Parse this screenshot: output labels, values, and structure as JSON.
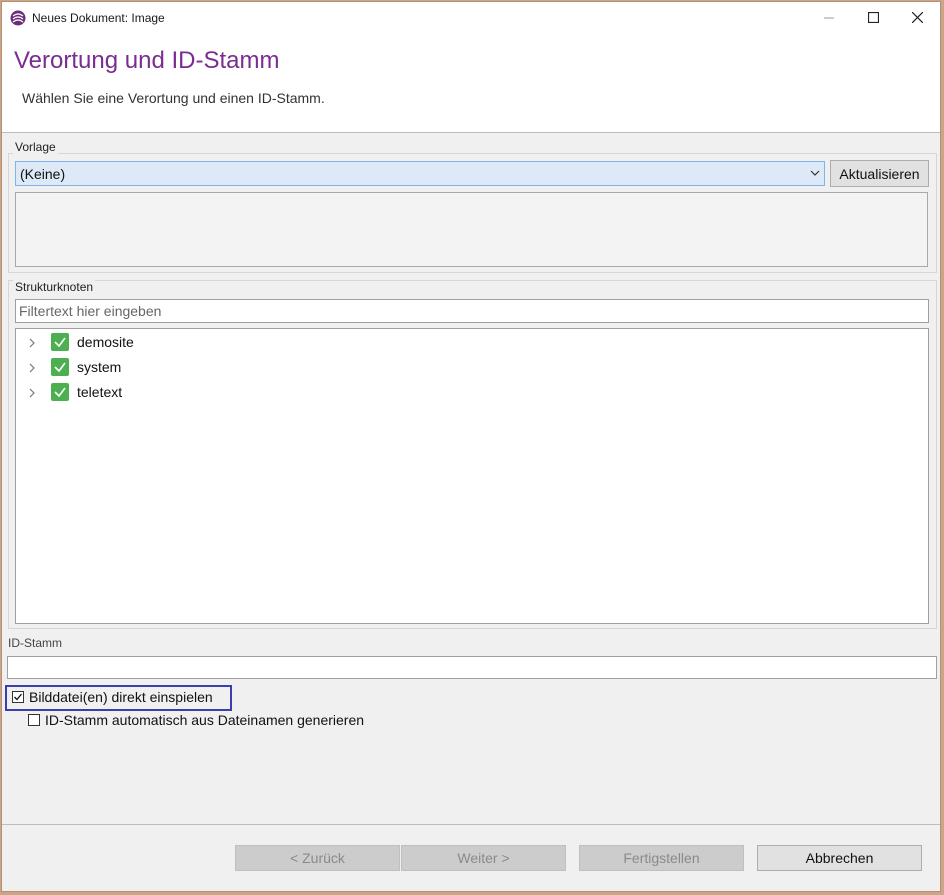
{
  "window": {
    "title": "Neues Dokument: Image",
    "minimize_icon": "minimize-icon",
    "maximize_icon": "maximize-icon",
    "close_icon": "close-icon"
  },
  "header": {
    "title": "Verortung und ID-Stamm",
    "subtitle": "Wählen Sie eine Verortung und einen ID-Stamm."
  },
  "vorlage": {
    "label": "Vorlage",
    "selected": "(Keine)",
    "refresh_label": "Aktualisieren"
  },
  "strukturknoten": {
    "label": "Strukturknoten",
    "filter_placeholder": "Filtertext hier eingeben",
    "items": [
      {
        "label": "demosite",
        "checked": true
      },
      {
        "label": "system",
        "checked": true
      },
      {
        "label": "teletext",
        "checked": true
      }
    ]
  },
  "idstamm": {
    "label": "ID-Stamm",
    "value": ""
  },
  "options": {
    "bilddatei_label": "Bilddatei(en) direkt einspielen",
    "bilddatei_checked": true,
    "auto_id_label": "ID-Stamm automatisch aus Dateinamen generieren",
    "auto_id_checked": false
  },
  "footer": {
    "back_label": "< Zurück",
    "next_label": "Weiter >",
    "finish_label": "Fertigstellen",
    "cancel_label": "Abbrechen"
  },
  "colors": {
    "accent_title": "#7a2c92",
    "check_green": "#4caf50",
    "highlight_border": "#3b3fad"
  }
}
